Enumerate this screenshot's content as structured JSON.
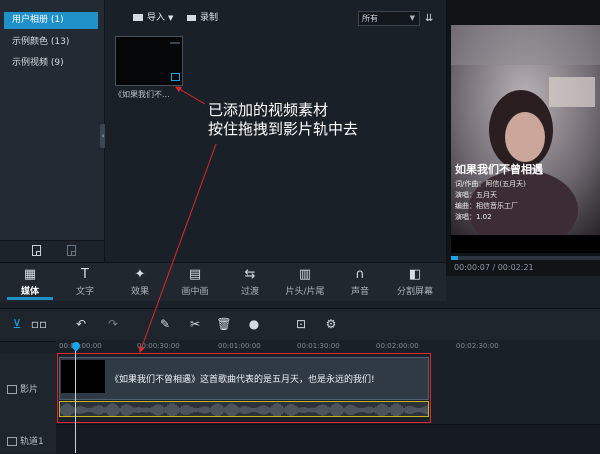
{
  "sidebar": {
    "items": [
      {
        "label": "用户相册 (1)",
        "active": true
      },
      {
        "label": "示例颜色 (13)",
        "active": false
      },
      {
        "label": "示例视频 (9)",
        "active": false
      }
    ]
  },
  "media_toolbar": {
    "import_label": "导入",
    "record_label": "录制",
    "filter_value": "所有"
  },
  "media_item": {
    "caption": "《如果我们不..."
  },
  "annotation": {
    "line1": "已添加的视频素材",
    "line2": "按住拖拽到影片轨中去"
  },
  "preview": {
    "timecode": "00:00:07 / 00:02:21",
    "progress_fraction": 0.05,
    "subtitles": [
      "如果我们不曾相遇",
      "词/作曲：阿信(五月天)",
      "演唱：五月天",
      "编曲：相信音乐工厂",
      "演唱：1.02"
    ]
  },
  "tabs": [
    {
      "label": "媒体",
      "active": true,
      "icon": "media-icon"
    },
    {
      "label": "文字",
      "active": false,
      "icon": "text-icon"
    },
    {
      "label": "效果",
      "active": false,
      "icon": "effects-icon"
    },
    {
      "label": "画中画",
      "active": false,
      "icon": "pip-icon"
    },
    {
      "label": "过渡",
      "active": false,
      "icon": "transition-icon"
    },
    {
      "label": "片头/片尾",
      "active": false,
      "icon": "intro-outro-icon"
    },
    {
      "label": "声音",
      "active": false,
      "icon": "sound-icon"
    },
    {
      "label": "分割屏幕",
      "active": false,
      "icon": "split-screen-icon"
    }
  ],
  "ruler": {
    "ticks": [
      "00:00:00:00",
      "00:00:30:00",
      "00:01:00:00",
      "00:01:30:00",
      "00:02:00:00",
      "00:02:30:00"
    ]
  },
  "tracks": {
    "video_label": "影片",
    "track1_label": "轨道1",
    "clip_title": "《如果我们不曾相遇》这首歌曲代表的是五月天，也是永远的我们!"
  },
  "colors": {
    "accent": "#1f90c8",
    "playhead": "#1aa3e8",
    "annotation_arrow": "#e0282e",
    "audio_border": "#c8b323"
  }
}
